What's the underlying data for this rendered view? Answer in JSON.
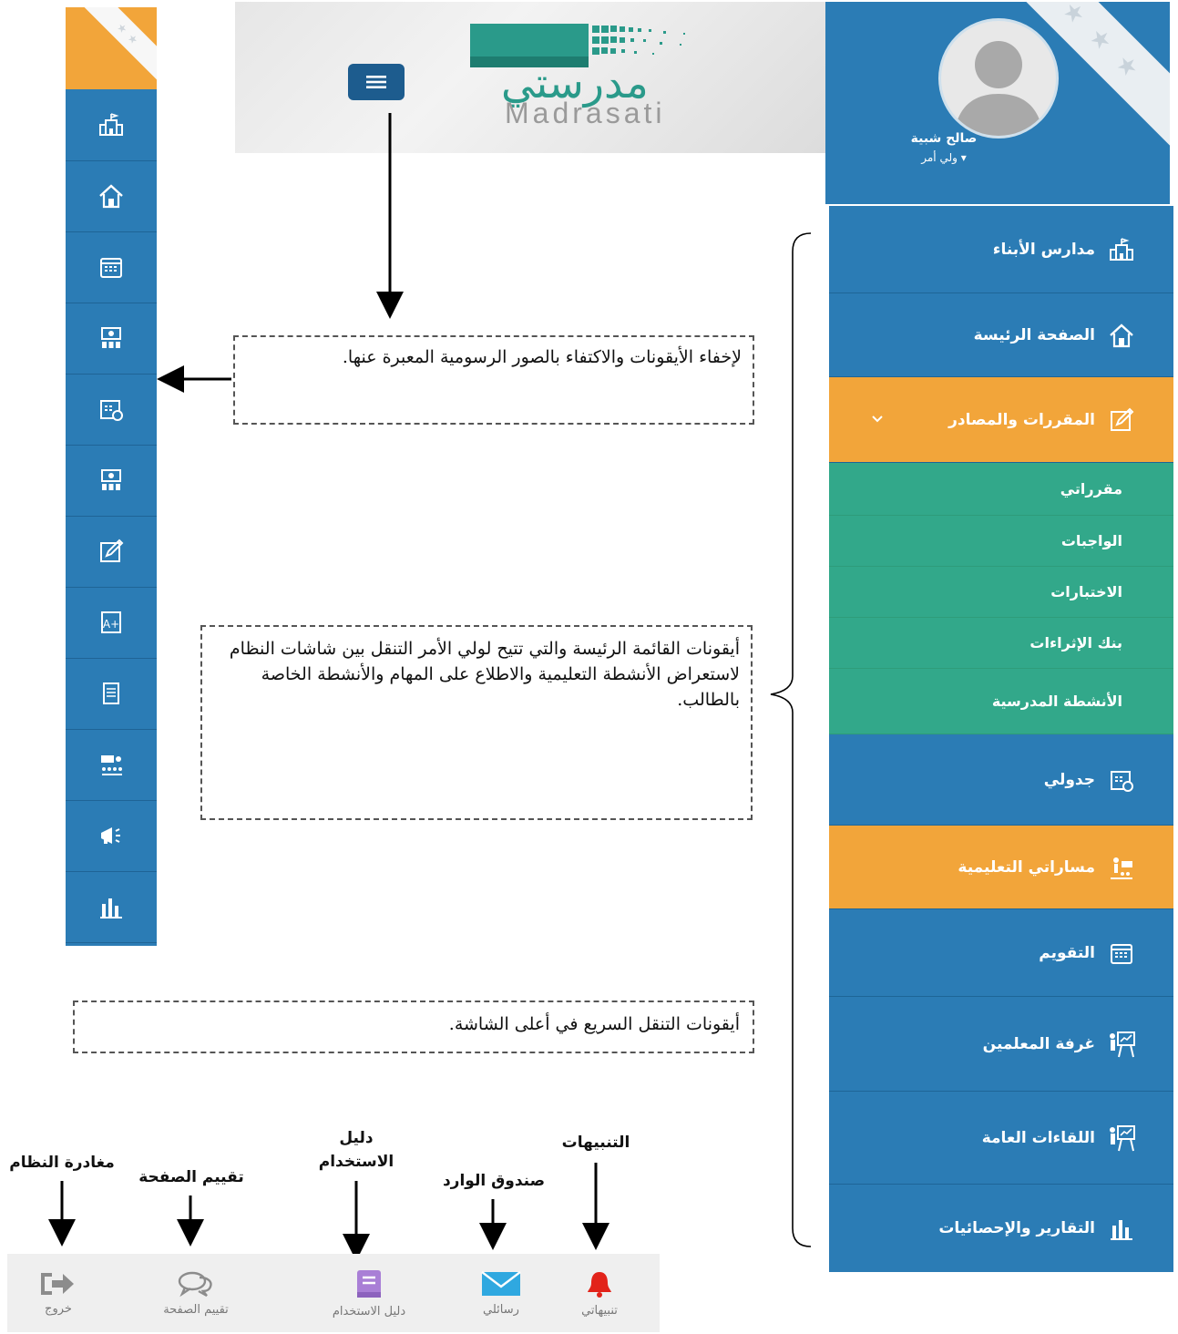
{
  "banner": {
    "logo_arabic": "مدرستي",
    "logo_latin": "Madrasati"
  },
  "profile": {
    "user_name": "صالح شبية",
    "role": "ولي أمر ▾"
  },
  "sidebar": {
    "items": [
      {
        "label": "مدارس الأبناء",
        "icon": "school-icon"
      },
      {
        "label": "الصفحة الرئيسة",
        "icon": "home-icon"
      },
      {
        "label": "المقررات والمصادر",
        "icon": "edit-icon"
      },
      {
        "label": "جدولي",
        "icon": "schedule-icon"
      },
      {
        "label": "مساراتي التعليمية",
        "icon": "learning-path-icon"
      },
      {
        "label": "التقويم",
        "icon": "calendar-icon"
      },
      {
        "label": "غرفة المعلمين",
        "icon": "teacher-board-icon"
      },
      {
        "label": "اللقاءات العامة",
        "icon": "meeting-board-icon"
      },
      {
        "label": "التقارير والإحصائيات",
        "icon": "bar-chart-icon"
      }
    ],
    "submenu": [
      "مقرراتي",
      "الواجبات",
      "الاختبارات",
      "بنك الإثراءات",
      "الأنشطة المدرسية"
    ],
    "expand_icon": "chevron-down-icon"
  },
  "annotations": {
    "hide_icons": "لإخفاء الأيقونات والاكتفاء بالصور الرسومية المعبرة عنها.",
    "main_menu": "أيقونات القائمة الرئيسة والتي تتيح لولي الأمر التنقل بين شاشات النظام لاستعراض الأنشطة التعليمية والاطلاع على المهام والأنشطة الخاصة بالطالب.",
    "quick_nav": "أيقونات التنقل السريع في أعلى الشاشة.",
    "labels": {
      "logout": "مغادرة النظام",
      "rate": "تقييم الصفحة",
      "guide": "دليل الاستخدام",
      "inbox": "صندوق الوارد",
      "alerts": "التنبيهات"
    }
  },
  "toolbar": {
    "logout": "خروج",
    "rate": "تقييم الصفحة",
    "guide": "دليل الاستخدام",
    "messages": "رسائلي",
    "alerts": "تنبيهاتي"
  },
  "colors": {
    "sidebar_blue": "#2b7cb5",
    "active_orange": "#f2a53a",
    "submenu_green": "#32a88a",
    "brand_teal": "#2a9a8a",
    "alert_red": "#e2231a",
    "mail_blue": "#2fa8e0",
    "guide_purple": "#a97fd6"
  }
}
